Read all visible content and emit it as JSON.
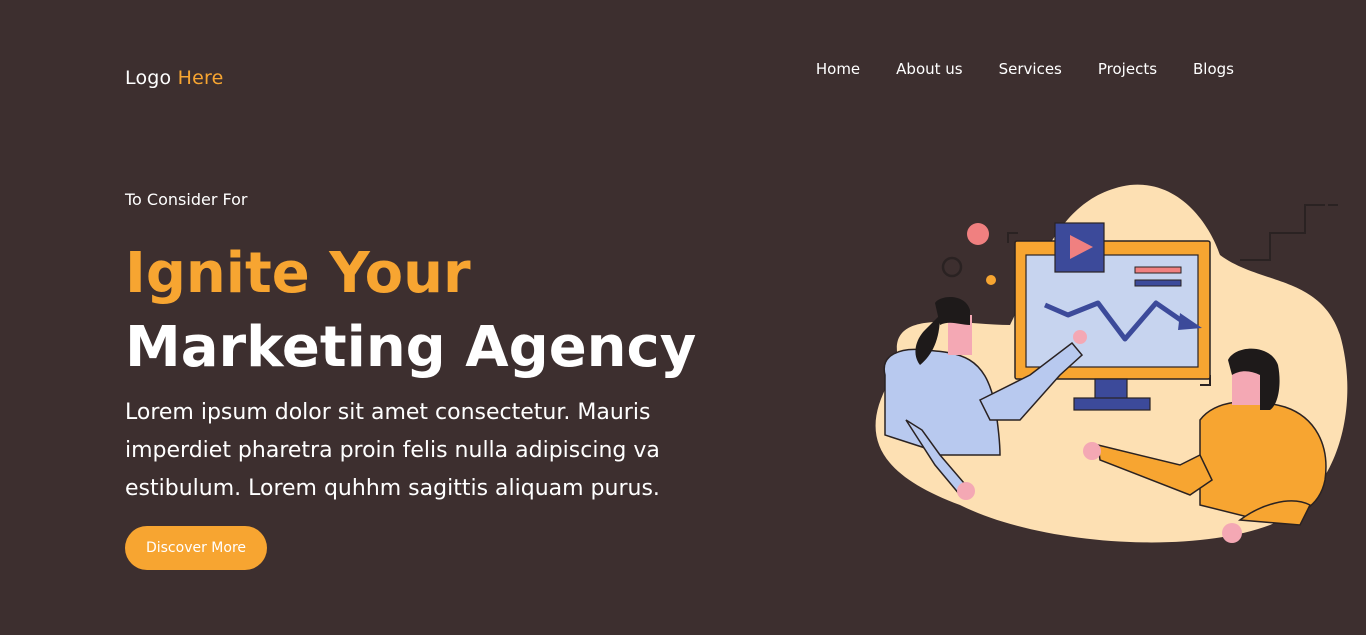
{
  "header": {
    "logo_text": "Logo",
    "logo_accent": "Here",
    "nav": [
      "Home",
      "About us",
      "Services",
      "Projects",
      "Blogs"
    ]
  },
  "hero": {
    "eyebrow": "To Consider For",
    "title_line1": "Ignite Your",
    "title_line2": "Marketing Agency",
    "description": "Lorem ipsum dolor sit amet consectetur. Mauris imperdiet pharetra proin felis nulla adipiscing va estibulum. Lorem quhhm sagittis aliquam purus.",
    "cta_label": "Discover More"
  },
  "theme": {
    "background": "#3d2f2f",
    "accent": "#f7a531",
    "illustration_blob": "#fde0b3",
    "illustration_screen": "#c7d4ef",
    "illustration_blue": "#3c4a9a",
    "illustration_pink": "#f08080"
  },
  "illustration": {
    "icons": [
      "play-icon",
      "trend-chart-icon"
    ]
  }
}
